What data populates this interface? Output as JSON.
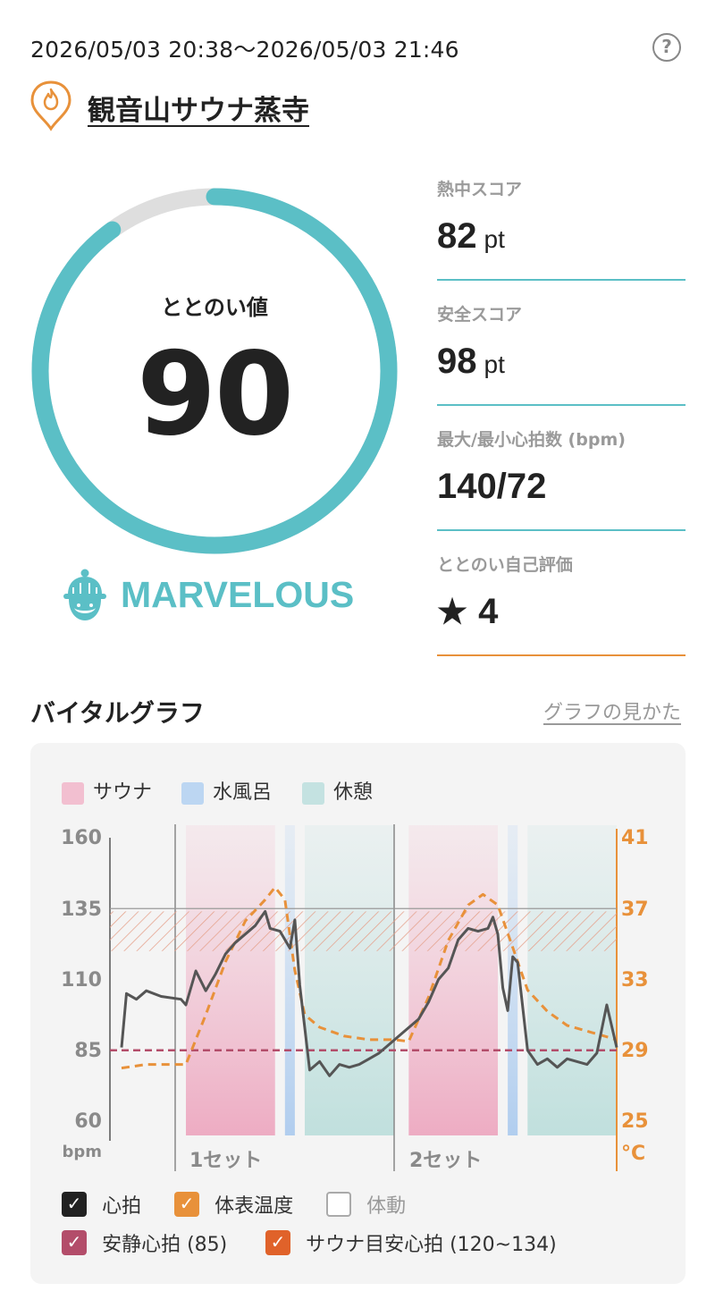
{
  "header": {
    "datetime_range": "2026/05/03 20:38～2026/05/03 21:46",
    "help_icon": "question-circle-icon",
    "place_icon": "flame-pin-icon",
    "place_name": "観音山サウナ蒸寺"
  },
  "totonoi": {
    "label": "ととのい値",
    "value": "90",
    "progress_percent": 90,
    "rank_icon": "sauna-hat-face-icon",
    "rank": "MARVELOUS"
  },
  "stats": [
    {
      "label": "熱中スコア",
      "value": "82",
      "unit": "pt"
    },
    {
      "label": "安全スコア",
      "value": "98",
      "unit": "pt"
    },
    {
      "label": "最大/最小心拍数 (bpm)",
      "value": "140/72",
      "unit": ""
    },
    {
      "label": "ととのい自己評価",
      "value": "4",
      "unit": "",
      "icon": "star-icon"
    }
  ],
  "vital_section": {
    "title": "バイタルグラフ",
    "how_to_link": "グラフの見かた"
  },
  "legend": [
    {
      "label": "サウナ",
      "color": "#f2bfd0"
    },
    {
      "label": "水風呂",
      "color": "#bcd6f2"
    },
    {
      "label": "休憩",
      "color": "#c4e2e1"
    }
  ],
  "chart_data": {
    "type": "line",
    "y_left": {
      "unit": "bpm",
      "ticks": [
        "160",
        "135",
        "110",
        "85",
        "60"
      ],
      "range": [
        60,
        160
      ]
    },
    "y_right": {
      "unit": "°C",
      "ticks": [
        "41",
        "37",
        "33",
        "29",
        "25"
      ],
      "range": [
        25,
        41
      ]
    },
    "x_labels": [
      "1セット",
      "2セット"
    ],
    "phases": [
      {
        "type": "sauna",
        "start": 0.13,
        "end": 0.31
      },
      {
        "type": "water",
        "start": 0.33,
        "end": 0.35
      },
      {
        "type": "rest",
        "start": 0.37,
        "end": 0.55
      },
      {
        "type": "sauna",
        "start": 0.58,
        "end": 0.76
      },
      {
        "type": "water",
        "start": 0.78,
        "end": 0.8
      },
      {
        "type": "rest",
        "start": 0.82,
        "end": 1.0
      }
    ],
    "resting_hr": 85,
    "target_hr_band": [
      120,
      134
    ],
    "series": [
      {
        "name": "心拍",
        "color": "#555555",
        "values": [
          [
            0.0,
            86
          ],
          [
            0.01,
            105
          ],
          [
            0.03,
            103
          ],
          [
            0.05,
            106
          ],
          [
            0.08,
            104
          ],
          [
            0.12,
            103
          ],
          [
            0.13,
            101
          ],
          [
            0.15,
            113
          ],
          [
            0.17,
            106
          ],
          [
            0.19,
            112
          ],
          [
            0.21,
            119
          ],
          [
            0.23,
            123
          ],
          [
            0.25,
            126
          ],
          [
            0.27,
            129
          ],
          [
            0.29,
            134
          ],
          [
            0.3,
            128
          ],
          [
            0.32,
            127
          ],
          [
            0.34,
            121
          ],
          [
            0.35,
            131
          ],
          [
            0.36,
            108
          ],
          [
            0.38,
            78
          ],
          [
            0.4,
            81
          ],
          [
            0.42,
            76
          ],
          [
            0.44,
            80
          ],
          [
            0.46,
            79
          ],
          [
            0.48,
            80
          ],
          [
            0.5,
            82
          ],
          [
            0.52,
            84
          ],
          [
            0.54,
            87
          ],
          [
            0.56,
            90
          ],
          [
            0.58,
            93
          ],
          [
            0.6,
            96
          ],
          [
            0.62,
            102
          ],
          [
            0.64,
            110
          ],
          [
            0.66,
            114
          ],
          [
            0.68,
            124
          ],
          [
            0.7,
            128
          ],
          [
            0.72,
            127
          ],
          [
            0.74,
            128
          ],
          [
            0.75,
            132
          ],
          [
            0.76,
            126
          ],
          [
            0.77,
            107
          ],
          [
            0.78,
            99
          ],
          [
            0.79,
            118
          ],
          [
            0.8,
            116
          ],
          [
            0.82,
            85
          ],
          [
            0.84,
            80
          ],
          [
            0.86,
            82
          ],
          [
            0.88,
            79
          ],
          [
            0.9,
            82
          ],
          [
            0.92,
            81
          ],
          [
            0.94,
            80
          ],
          [
            0.96,
            84
          ],
          [
            0.98,
            101
          ],
          [
            1.0,
            86
          ]
        ]
      },
      {
        "name": "体表温度",
        "color": "#e8913a",
        "values": [
          [
            0.0,
            28.0
          ],
          [
            0.05,
            28.2
          ],
          [
            0.13,
            28.2
          ],
          [
            0.17,
            31
          ],
          [
            0.21,
            34
          ],
          [
            0.25,
            36.3
          ],
          [
            0.29,
            37.5
          ],
          [
            0.31,
            38.2
          ],
          [
            0.33,
            37.5
          ],
          [
            0.35,
            33.5
          ],
          [
            0.37,
            31
          ],
          [
            0.4,
            30.3
          ],
          [
            0.45,
            29.8
          ],
          [
            0.5,
            29.6
          ],
          [
            0.55,
            29.6
          ],
          [
            0.58,
            29.5
          ],
          [
            0.62,
            32
          ],
          [
            0.66,
            35.2
          ],
          [
            0.7,
            37.2
          ],
          [
            0.73,
            37.8
          ],
          [
            0.76,
            37.2
          ],
          [
            0.79,
            34.8
          ],
          [
            0.82,
            32.4
          ],
          [
            0.86,
            31.2
          ],
          [
            0.9,
            30.4
          ],
          [
            0.95,
            30.0
          ],
          [
            1.0,
            29.6
          ]
        ]
      }
    ]
  },
  "toggles": [
    {
      "label": "心拍",
      "checked": true,
      "color": "#222222"
    },
    {
      "label": "体表温度",
      "checked": true,
      "color": "#e8913a"
    },
    {
      "label": "体動",
      "checked": false,
      "color": "#aaaaaa"
    },
    {
      "label": "安静心拍 (85)",
      "checked": true,
      "color": "#b34d6a"
    },
    {
      "label": "サウナ目安心拍 (120~134)",
      "checked": true,
      "color": "#e0622a"
    }
  ]
}
